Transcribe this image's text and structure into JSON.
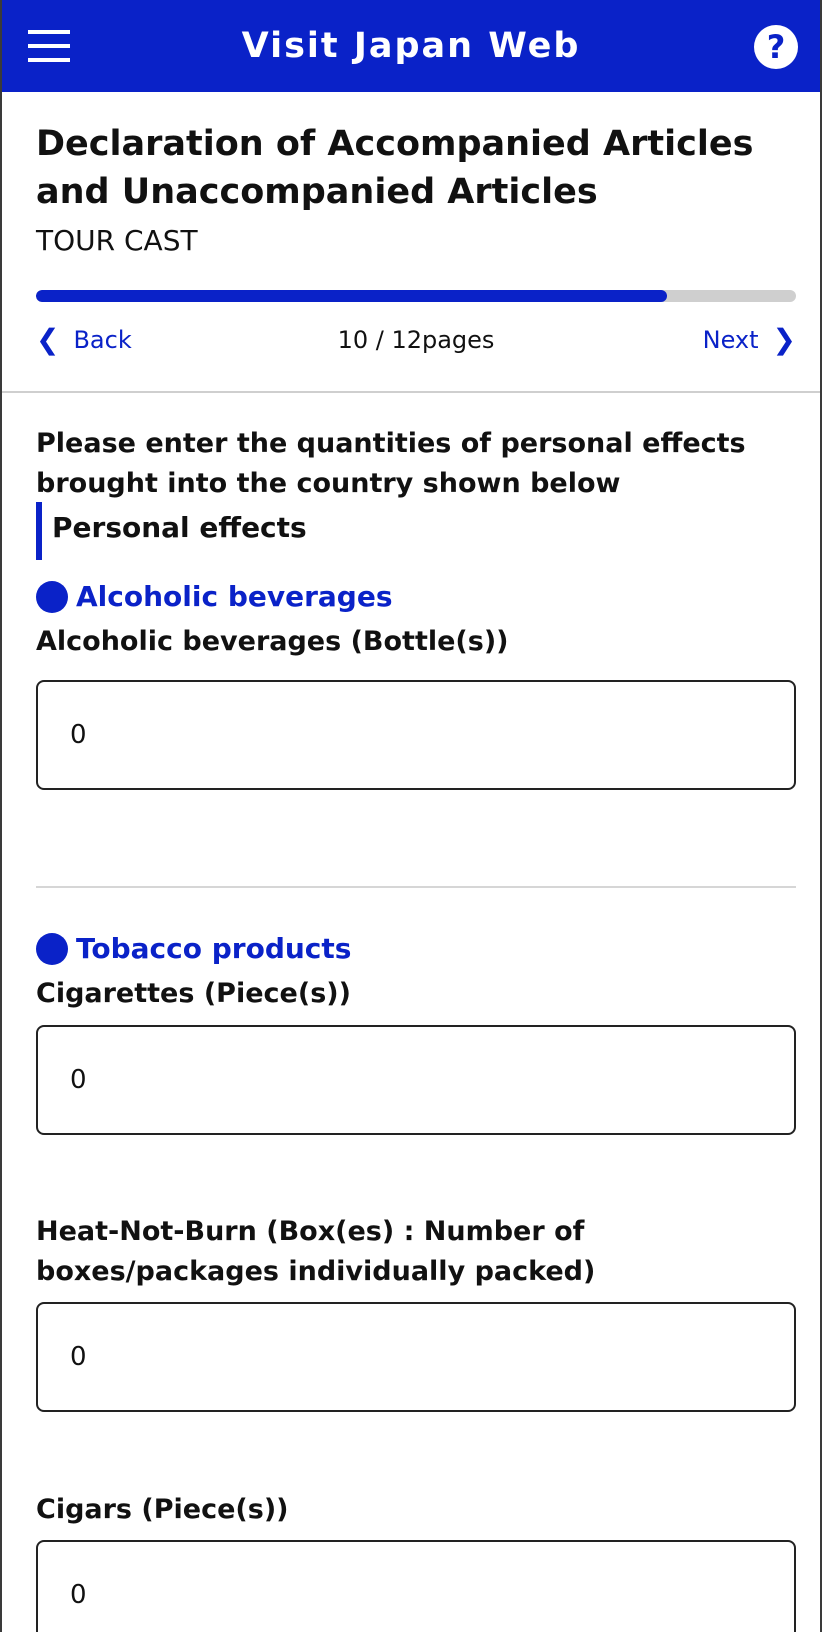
{
  "topbar": {
    "title": "Visit Japan Web",
    "help_symbol": "?"
  },
  "header": {
    "title": "Declaration of Accompanied Articles and Unaccompanied Articles",
    "subtitle": "TOUR CAST"
  },
  "progress": {
    "current": 10,
    "total": 12,
    "fraction": 0.83
  },
  "pager": {
    "back_label": "Back",
    "next_label": "Next",
    "page_text": "10 / 12pages"
  },
  "instructions": "Please enter the quantities of personal effects brought into the country shown below",
  "section_title": "Personal effects",
  "categories": {
    "alcohol": "Alcoholic beverages",
    "tobacco": "Tobacco products"
  },
  "fields": {
    "alcohol_bottles": {
      "label": "Alcoholic beverages (Bottle(s))",
      "value": "0"
    },
    "cigarettes": {
      "label": "Cigarettes (Piece(s))",
      "value": "0"
    },
    "heat_not_burn": {
      "label": "Heat-Not-Burn (Box(es) : Number of boxes/packages individually packed)",
      "value": "0"
    },
    "cigars": {
      "label": "Cigars (Piece(s))",
      "value": "0"
    }
  },
  "colors": {
    "brand": "#0a22c8",
    "track": "#cfcfcf"
  },
  "icons": {
    "menu": "hamburger-menu-icon",
    "help": "help-icon",
    "back": "chevron-left-icon",
    "next": "chevron-right-icon"
  }
}
